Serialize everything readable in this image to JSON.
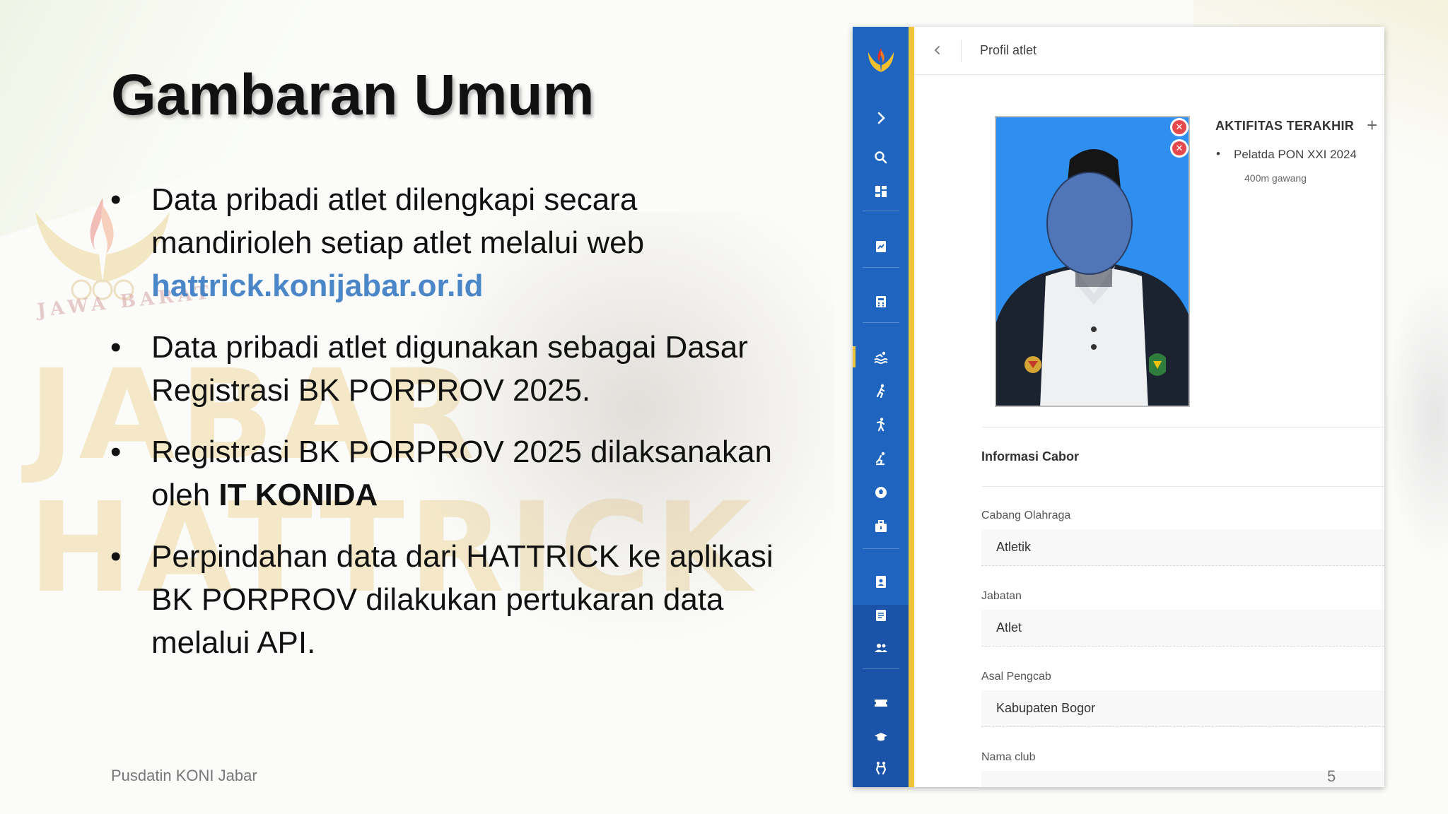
{
  "slide": {
    "title": "Gambaran Umum",
    "bullets": [
      {
        "text": "Data pribadi atlet dilengkapi secara mandirioleh setiap atlet melalui web",
        "link": "hattrick.konijabar.or.id"
      },
      {
        "text": "Data pribadi atlet digunakan sebagai Dasar Registrasi BK PORPROV 2025."
      },
      {
        "text": "Registrasi BK PORPROV 2025 dilaksanakan oleh ",
        "strong": "IT KONIDA"
      },
      {
        "text": "Perpindahan data dari HATTRICK ke aplikasi BK PORPROV dilakukan pertukaran data melalui API."
      }
    ],
    "footer": "Pusdatin KONI Jabar",
    "page_number": "5",
    "background": {
      "logo_text": "JAWA BARAT",
      "big_words": [
        "JABAR",
        "HATTRICK"
      ]
    }
  },
  "app": {
    "breadcrumb": "Profil atlet",
    "activity": {
      "heading": "AKTIFITAS TERAKHIR",
      "add_symbol": "+",
      "items": [
        {
          "title": "Pelatda PON XXI 2024",
          "subtitle": "400m gawang"
        }
      ]
    },
    "section_title": "Informasi Cabor",
    "fields": [
      {
        "label": "Cabang Olahraga",
        "value": "Atletik"
      },
      {
        "label": "Jabatan",
        "value": "Atlet"
      },
      {
        "label": "Asal Pengcab",
        "value": "Kabupaten Bogor"
      },
      {
        "label": "Nama club",
        "value": "-"
      }
    ],
    "sidebar_icons": [
      "expand-chevron-icon",
      "search-icon",
      "dashboard-icon",
      "report-icon",
      "calculator-icon",
      "swimming-icon",
      "athletics-icon",
      "running-icon",
      "skating-icon",
      "ball-icon",
      "toolbox-icon",
      "id-badge-icon",
      "document-icon",
      "users-icon",
      "ticket-icon",
      "hat-icon",
      "wrestling-icon"
    ],
    "colors": {
      "sidebar": "#1f65c0",
      "accent": "#f0c53a",
      "photo_bg": "#2f8ff0",
      "link": "#4a86c8"
    }
  }
}
